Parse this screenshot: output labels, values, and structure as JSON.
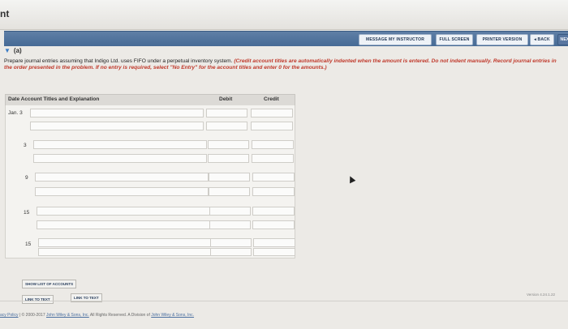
{
  "page": {
    "title": "nt"
  },
  "toolbar": {
    "message_label": "MESSAGE MY INSTRUCTOR",
    "fullscreen_label": "FULL SCREEN",
    "printer_label": "PRINTER VERSION",
    "back_label": "◂ BACK",
    "next_label": "NEX"
  },
  "section": {
    "label": "(a)"
  },
  "instructions": {
    "main": "Prepare journal entries assuming that Indigo Ltd. uses FIFO under a perpetual inventory system.",
    "note": "(Credit account titles are automatically indented when the amount is entered. Do not indent manually. Record journal entries in the order presented in the problem. If no entry is required, select \"No Entry\" for the account titles and enter 0 for the amounts.)"
  },
  "table": {
    "headers": {
      "date_acct": "Date  Account Titles and Explanation",
      "debit": "Debit",
      "credit": "Credit"
    },
    "dates": [
      "Jan. 3",
      "3",
      "9",
      "15",
      "15"
    ]
  },
  "buttons": {
    "show_accounts": "SHOW LIST OF ACCOUNTS",
    "link1": "LINK TO TEXT",
    "link2": "LINK TO TEXT"
  },
  "footer": {
    "version": "Version 4.24.1.22",
    "policy": "acy Policy",
    "copyright_prefix": "© 2000-2017",
    "copyright_link": "John Wiley & Sons, Inc.",
    "rights": "All Rights Reserved. A Division of",
    "division_link": "John Wiley & Sons, Inc."
  }
}
